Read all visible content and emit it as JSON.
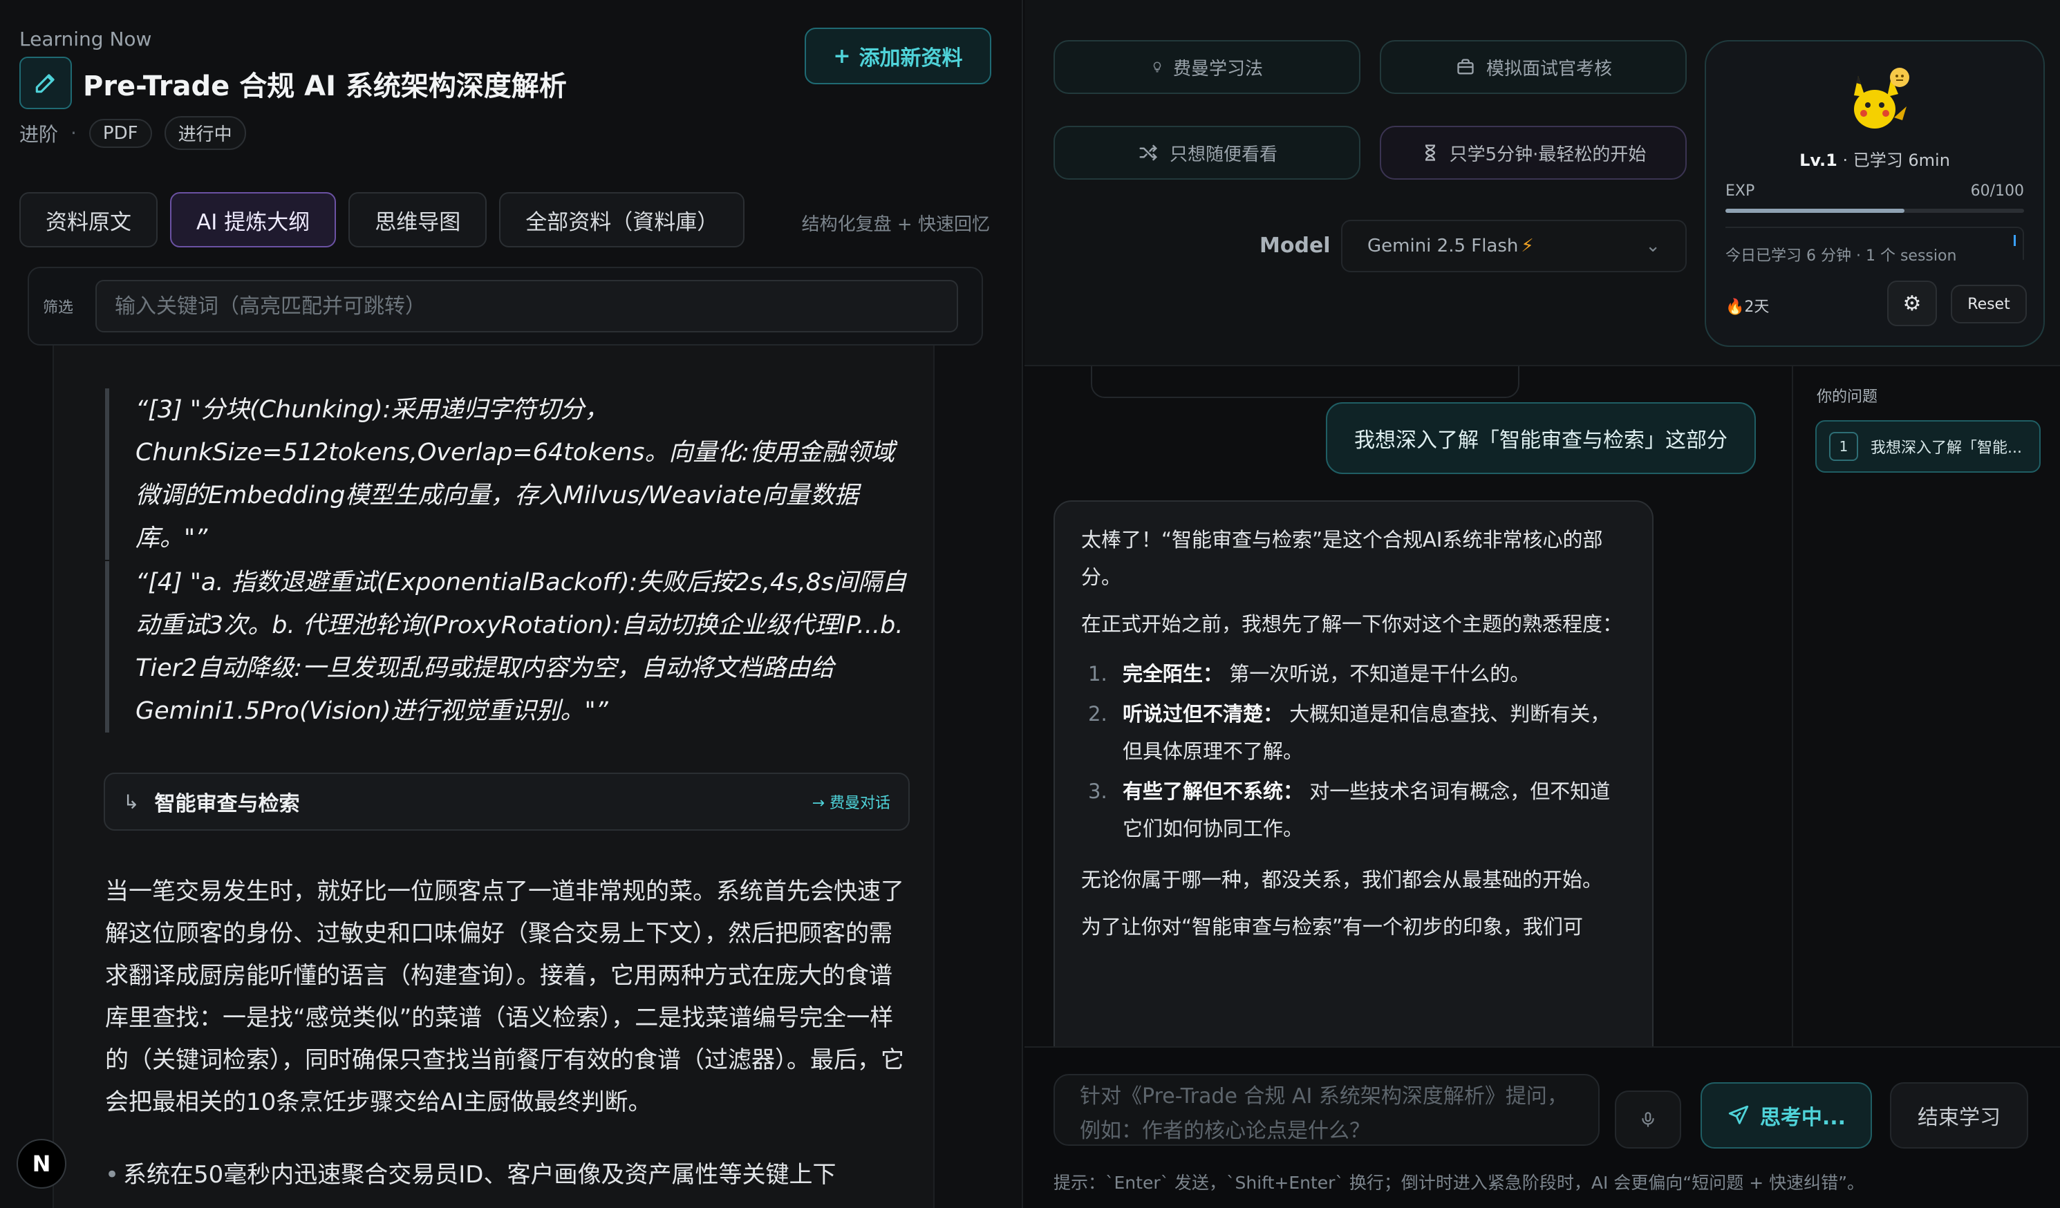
{
  "header": {
    "subtitle": "Learning Now",
    "title": "Pre-Trade 合规 AI 系统架构深度解析",
    "meta_level": "进阶",
    "meta_format": "PDF",
    "meta_status": "进行中",
    "add_button": "添加新资料"
  },
  "tabs": [
    {
      "label": "资料原文"
    },
    {
      "label": "AI 提炼大纲",
      "active": true
    },
    {
      "label": "思维导图"
    },
    {
      "label": "全部资料（資料庫）"
    }
  ],
  "tabs_hint": "结构化复盘 + 快速回忆",
  "filter": {
    "label": "筛选",
    "placeholder": "输入关键词（高亮匹配并可跳转）"
  },
  "document": {
    "quote1": "“[3] \"分块(Chunking):采用递归字符切分，ChunkSize=512tokens,Overlap=64tokens。向量化:使用金融领域微调的Embedding模型生成向量，存入Milvus/Weaviate向量数据库。\"”",
    "quote2": "“[4] \"a. 指数退避重试(ExponentialBackoff):失败后按2s,4s,8s间隔自动重试3次。b. 代理池轮询(ProxyRotation):自动切换企业级代理IP...b. Tier2自动降级:一旦发现乱码或提取内容为空，自动将文档路由给Gemini1.5Pro(Vision)进行视觉重识别。\"”",
    "section_title": "智能审查与检索",
    "section_link": "→ 费曼对话",
    "paragraph": "当一笔交易发生时，就好比一位顾客点了一道非常规的菜。系统首先会快速了解这位顾客的身份、过敏史和口味偏好（聚合交易上下文），然后把顾客的需求翻译成厨房能听懂的语言（构建查询）。接着，它用两种方式在庞大的食谱库里查找：一是找“感觉类似”的菜谱（语义检索），二是找菜谱编号完全一样的（关键词检索），同时确保只查找当前餐厅有效的食谱（过滤器）。最后，它会把最相关的10条烹饪步骤交给AI主厨做最终判断。",
    "bullet": "系统在50毫秒内迅速聚合交易员ID、客户画像及资产属性等关键上下"
  },
  "modes": {
    "feynman": "费曼学习法",
    "interview": "模拟面试官考核",
    "browse": "只想随便看看",
    "five_min": "只学5分钟·最轻松的开始"
  },
  "model": {
    "label": "Model",
    "value": "Gemini 2.5 Flash",
    "bolt": "⚡"
  },
  "profile": {
    "level": "Lv.1",
    "learned": " · 已学习 6min",
    "exp_label": "EXP",
    "exp_value": "60/100",
    "exp_fraction": 0.6,
    "today": "今日已学习 6 分钟 · 1 个 session",
    "streak": "🔥2天",
    "reset": "Reset"
  },
  "chat": {
    "user_message": "我想深入了解「智能审查与检索」这部分",
    "ai_intro": "太棒了！“智能审查与检索”是这个合规AI系统非常核心的部分。",
    "ai_ask": "在正式开始之前，我想先了解一下你对这个主题的熟悉程度：",
    "options": [
      {
        "num": "1.",
        "title": "完全陌生：",
        "desc": " 第一次听说，不知道是干什么的。"
      },
      {
        "num": "2.",
        "title": "听说过但不清楚：",
        "desc": " 大概知道是和信息查找、判断有关，但具体原理不了解。"
      },
      {
        "num": "3.",
        "title": "有些了解但不系统：",
        "desc": " 对一些技术名词有概念，但不知道它们如何协同工作。"
      }
    ],
    "ai_reassure": "无论你属于哪一种，都没关系，我们都会从最基础的开始。",
    "ai_cont": "为了让你对“智能审查与检索”有一个初步的印象，我们可"
  },
  "questions": {
    "title": "你的问题",
    "items": [
      {
        "num": "1",
        "text": "我想深入了解「智能..."
      }
    ]
  },
  "composer": {
    "placeholder": "针对《Pre-Trade 合规 AI 系统架构深度解析》提问，例如：作者的核心论点是什么？",
    "send": "思考中...",
    "end": "结束学习",
    "hint": "提示：`Enter` 发送，`Shift+Enter` 换行；倒计时进入紧急阶段时，AI 会更偏向“短问题 + 快速纠错”。"
  },
  "colors": {
    "accent": "#4fd3d9",
    "active_tab": "#6b52a3",
    "background": "#0b0c0e"
  }
}
